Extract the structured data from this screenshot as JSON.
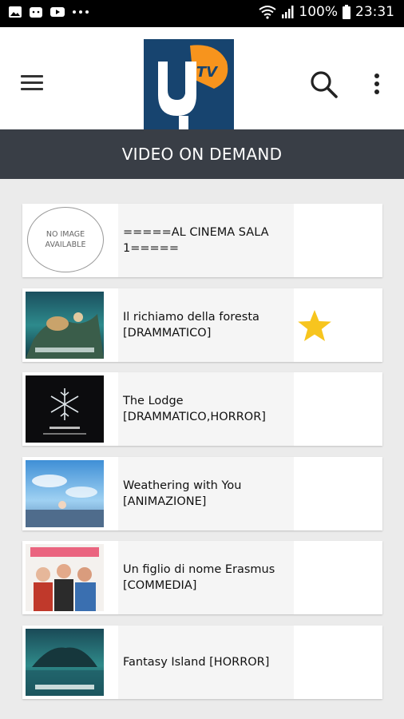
{
  "status": {
    "battery": "100%",
    "time": "23:31"
  },
  "logo": {
    "text": "TV"
  },
  "section": {
    "title": "VIDEO ON DEMAND"
  },
  "no_image": {
    "line1": "NO IMAGE",
    "line2": "AVAILABLE"
  },
  "items": [
    {
      "line1": "=====AL CINEMA SALA",
      "line2": "1=====",
      "poster": "none",
      "favorite": false
    },
    {
      "line1": "Il richiamo della foresta",
      "line2": "[DRAMMATICO]",
      "poster": "dog-sled-adventure",
      "favorite": true
    },
    {
      "line1": "The Lodge",
      "line2": "[DRAMMATICO,HORROR]",
      "poster": "snowflake-dark",
      "favorite": false
    },
    {
      "line1": "Weathering with You",
      "line2": "[ANIMAZIONE]",
      "poster": "anime-sky",
      "favorite": false
    },
    {
      "line1": "Un figlio di nome Erasmus",
      "line2": "[COMMEDIA]",
      "poster": "comedy-group",
      "favorite": false
    },
    {
      "line1": "Fantasy Island [HORROR]",
      "line2": "",
      "poster": "island-teal",
      "favorite": false
    }
  ],
  "colors": {
    "header_bar": "#393e46",
    "logo_bg": "#17446f",
    "logo_accent": "#f7941d",
    "star": "#f7c51e"
  }
}
